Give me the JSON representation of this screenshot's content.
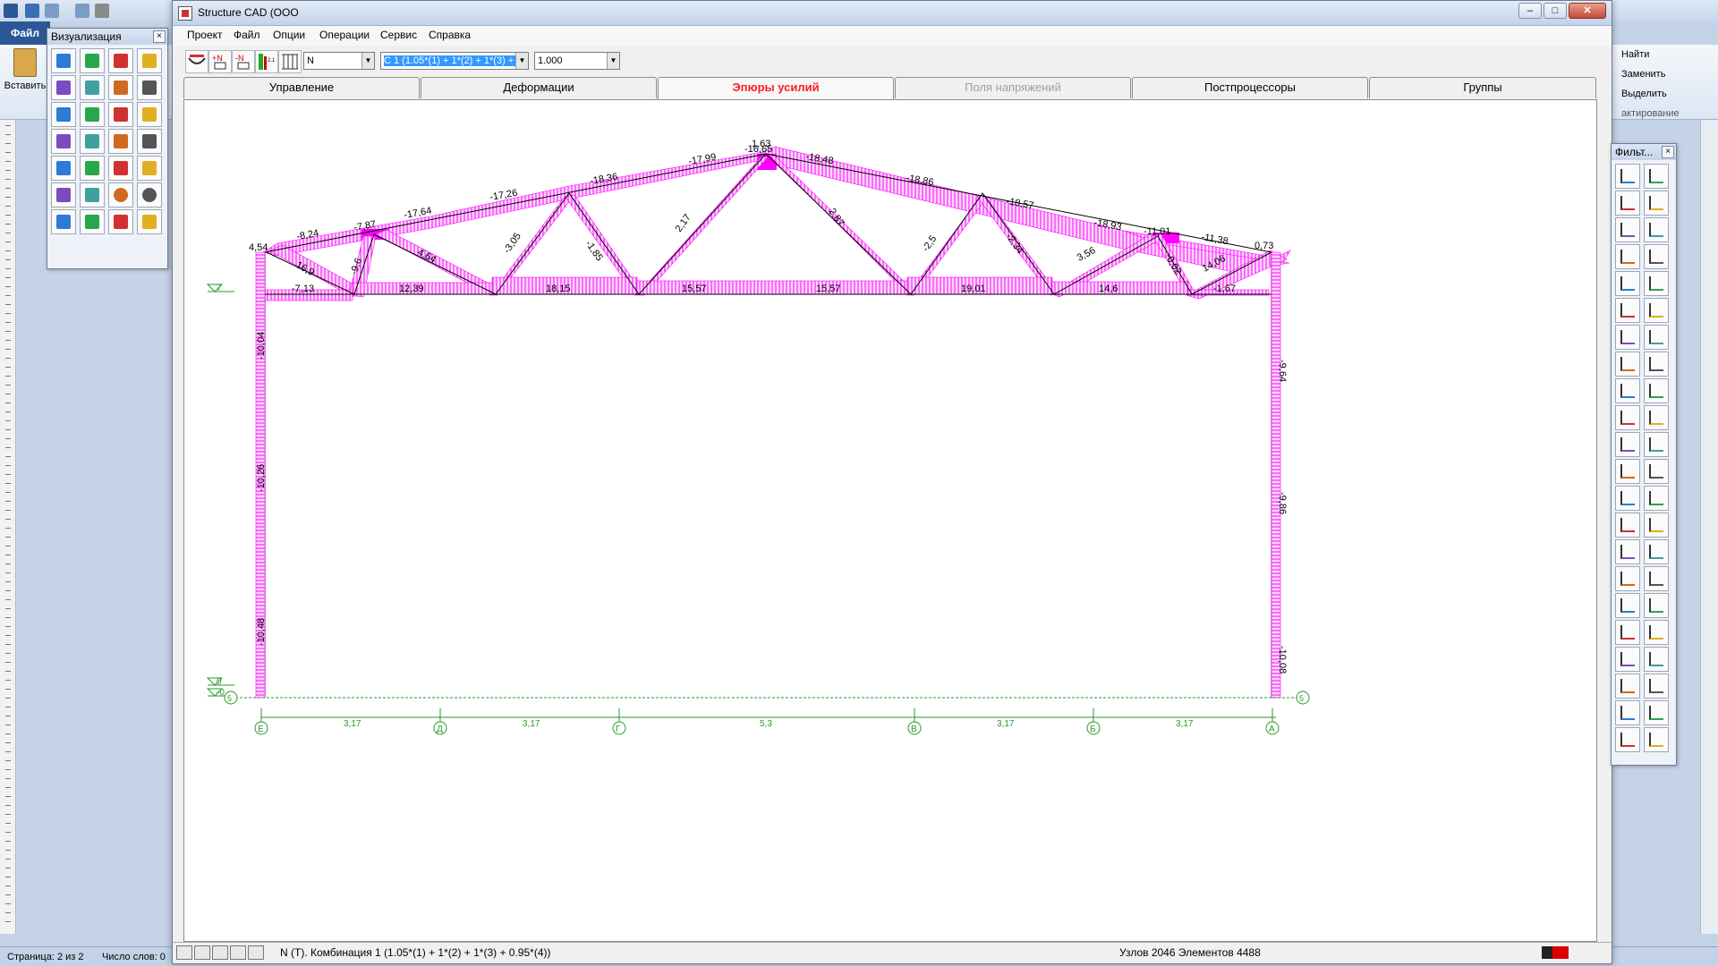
{
  "word": {
    "file_tab": "Файл",
    "paste_label": "Вставить",
    "find_label": "Найти",
    "replace_label": "Заменить",
    "select_label": "Выделить",
    "editing_label": "актирование",
    "status_page": "Страница: 2 из 2",
    "status_words": "Число слов: 0"
  },
  "cad": {
    "title": "Structure CAD (ООО",
    "window_controls": {
      "minimize": "–",
      "maximize": "□",
      "close": "✕"
    },
    "menu": [
      "Проект",
      "Файл",
      "Опции",
      "Операции",
      "Сервис",
      "Справка"
    ],
    "toolbar": {
      "force_combo_value": "N",
      "combination_value": "C 1 (1.05*(1) + 1*(2) + 1*(3) + 0.95*(4)",
      "scale_value": "1.000"
    },
    "tabs": [
      {
        "label": "Управление",
        "state": "normal"
      },
      {
        "label": "Деформации",
        "state": "normal"
      },
      {
        "label": "Эпюры усилий",
        "state": "active"
      },
      {
        "label": "Поля напряжений",
        "state": "disabled"
      },
      {
        "label": "Постпроцессоры",
        "state": "normal"
      },
      {
        "label": "Группы",
        "state": "normal"
      }
    ],
    "status_text": "N (T). Комбинация 1 (1.05*(1) + 1*(2) + 1*(3) + 0.95*(4))",
    "status_nodes": "Узлов 2046 Элементов 4488"
  },
  "palette_vis": {
    "title": "Визуализация",
    "close": "×"
  },
  "palette_filter": {
    "title": "Фильт...",
    "close": "×"
  },
  "drawing": {
    "level_top": "7",
    "level_zero": "0",
    "level_minus": "-0",
    "axis_row_label": "5",
    "axes": [
      "Е",
      "Д",
      "Г",
      "В",
      "Б",
      "А"
    ],
    "spans": [
      "3,17",
      "3,17",
      "5,3",
      "3,17",
      "3,17"
    ],
    "top_chord_labels": [
      "4,54",
      "-8,24",
      "-7,87",
      "-17,64",
      "-17,26",
      "-18,36",
      "-17,99",
      "-16,65",
      "-18,48",
      "-18,86",
      "-18,57",
      "-18,93",
      "-11,01",
      "-11,38",
      "0,73"
    ],
    "apex_label": "1,63",
    "diagonal_labels": [
      "16,9",
      "-9,6",
      "4,64",
      "-3,05",
      "-1,85",
      "2,17",
      "2,87",
      "-2,5",
      "-2,34",
      "3,56",
      "-0,02",
      "14,06"
    ],
    "bottom_chord_labels": [
      "-7,13",
      "12,39",
      "18,15",
      "15,57",
      "15,57",
      "19,01",
      "14,6",
      "-1,67"
    ],
    "left_column_labels": [
      "-10,04",
      "-10,26",
      "-10,48"
    ],
    "right_column_labels": [
      "-9,64",
      "-9,86",
      "-10,08"
    ],
    "diagram_color": "#ff00ff"
  }
}
